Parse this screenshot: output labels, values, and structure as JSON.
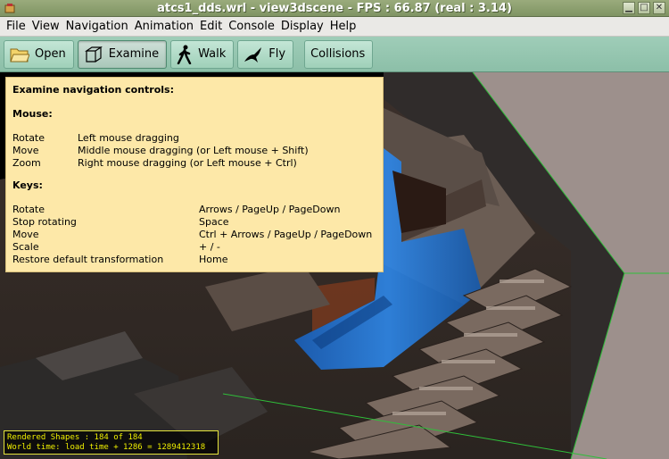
{
  "window": {
    "title": "atcs1_dds.wrl - view3dscene - FPS : 66.87 (real : 3.14)",
    "buttons": [
      "minimize",
      "maximize",
      "close"
    ]
  },
  "menu": {
    "items": [
      {
        "label": "File"
      },
      {
        "label": "View"
      },
      {
        "label": "Navigation"
      },
      {
        "label": "Animation"
      },
      {
        "label": "Edit"
      },
      {
        "label": "Console"
      },
      {
        "label": "Display"
      },
      {
        "label": "Help"
      }
    ]
  },
  "toolbar": {
    "open_label": "Open",
    "examine_label": "Examine",
    "walk_label": "Walk",
    "fly_label": "Fly",
    "collisions_label": "Collisions",
    "active_mode": "Examine"
  },
  "help": {
    "title": "Examine navigation controls:",
    "mouse_heading": "Mouse:",
    "mouse_rows": [
      {
        "action": "Rotate",
        "control": "Left mouse dragging"
      },
      {
        "action": "Move",
        "control": "Middle mouse dragging (or Left mouse + Shift)"
      },
      {
        "action": "Zoom",
        "control": "Right mouse dragging (or Left mouse + Ctrl)"
      }
    ],
    "keys_heading": "Keys:",
    "key_rows": [
      {
        "action": "Rotate",
        "control": "Arrows / PageUp / PageDown"
      },
      {
        "action": "Stop rotating",
        "control": "Space"
      },
      {
        "action": "Move",
        "control": "Ctrl + Arrows / PageUp / PageDown"
      },
      {
        "action": "Scale",
        "control": "+ / -"
      },
      {
        "action": "Restore default transformation",
        "control": "Home"
      }
    ]
  },
  "status": {
    "line1": "Rendered Shapes : 184 of 184",
    "line2": "World time: load time + 1286 = 1289412318"
  },
  "colors": {
    "help_bg": "#fde8a8",
    "status_text": "#f0f000",
    "bbox_edge": "#2fbf3a",
    "water": "#1f6fd8"
  }
}
